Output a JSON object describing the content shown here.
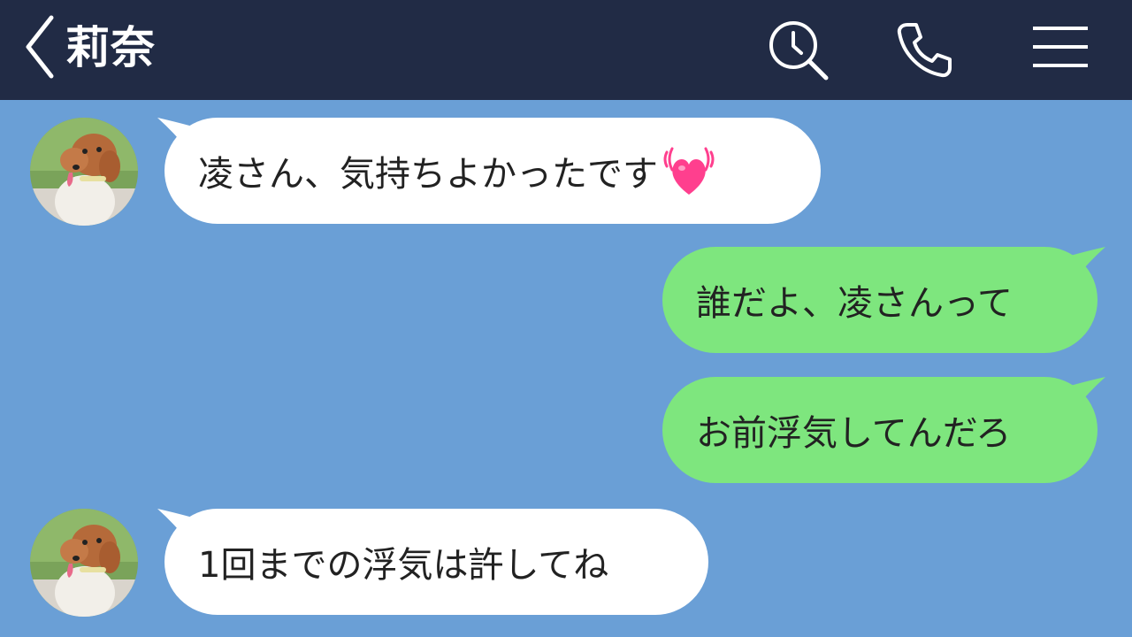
{
  "header": {
    "title": "莉奈",
    "icons": [
      "back-icon",
      "search-history-icon",
      "phone-icon",
      "menu-icon"
    ],
    "background": "#212b45"
  },
  "chat": {
    "background": "#6a9fd6",
    "incoming_bubble_color": "#ffffff",
    "outgoing_bubble_color": "#7ee67e",
    "messages": [
      {
        "sender": "contact",
        "text": "凌さん、気持ちよかったです",
        "emoji": "heart-emoji"
      },
      {
        "sender": "me",
        "text": "誰だよ、凌さんって"
      },
      {
        "sender": "me",
        "text": "お前浮気してんだろ"
      },
      {
        "sender": "contact",
        "text": "1回までの浮気は許してね"
      }
    ]
  }
}
